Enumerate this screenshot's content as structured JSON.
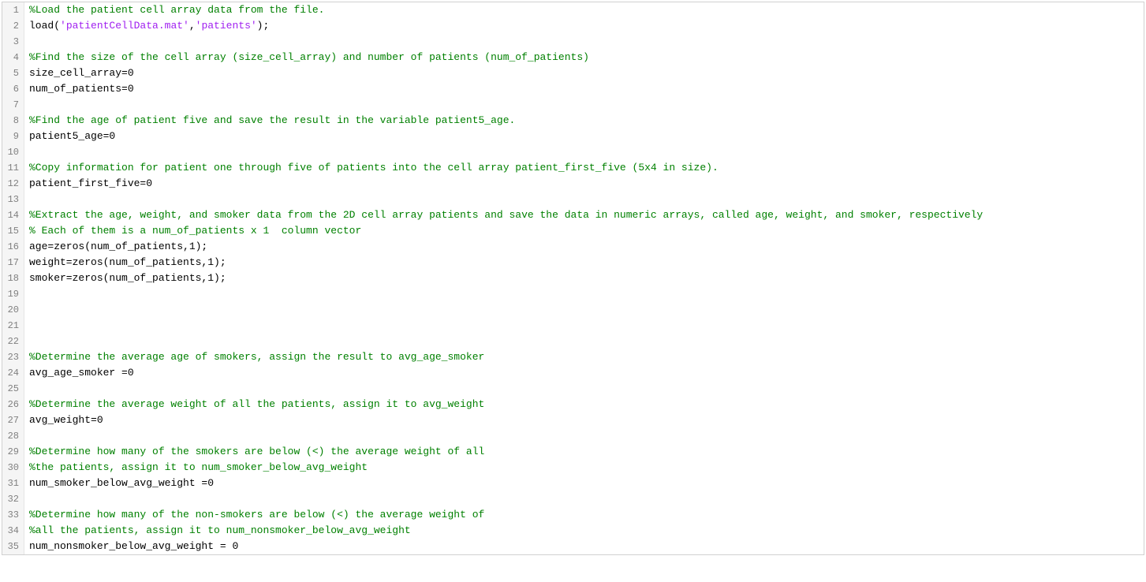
{
  "editor": {
    "lines": [
      {
        "num": 1,
        "tokens": [
          {
            "cls": "tok-comment",
            "text": "%Load the patient cell array data from the file."
          }
        ]
      },
      {
        "num": 2,
        "tokens": [
          {
            "cls": "tok-default",
            "text": "load("
          },
          {
            "cls": "tok-string",
            "text": "'patientCellData.mat'"
          },
          {
            "cls": "tok-default",
            "text": ","
          },
          {
            "cls": "tok-string",
            "text": "'patients'"
          },
          {
            "cls": "tok-default",
            "text": ");"
          }
        ]
      },
      {
        "num": 3,
        "tokens": []
      },
      {
        "num": 4,
        "tokens": [
          {
            "cls": "tok-comment",
            "text": "%Find the size of the cell array (size_cell_array) and number of patients (num_of_patients)"
          }
        ]
      },
      {
        "num": 5,
        "tokens": [
          {
            "cls": "tok-default",
            "text": "size_cell_array=0"
          }
        ]
      },
      {
        "num": 6,
        "tokens": [
          {
            "cls": "tok-default",
            "text": "num_of_patients=0"
          }
        ]
      },
      {
        "num": 7,
        "tokens": []
      },
      {
        "num": 8,
        "tokens": [
          {
            "cls": "tok-comment",
            "text": "%Find the age of patient five and save the result in the variable patient5_age."
          }
        ]
      },
      {
        "num": 9,
        "tokens": [
          {
            "cls": "tok-default",
            "text": "patient5_age=0"
          }
        ]
      },
      {
        "num": 10,
        "tokens": []
      },
      {
        "num": 11,
        "tokens": [
          {
            "cls": "tok-comment",
            "text": "%Copy information for patient one through five of patients into the cell array patient_first_five (5x4 in size)."
          }
        ]
      },
      {
        "num": 12,
        "tokens": [
          {
            "cls": "tok-default",
            "text": "patient_first_five=0"
          }
        ]
      },
      {
        "num": 13,
        "tokens": []
      },
      {
        "num": 14,
        "tokens": [
          {
            "cls": "tok-comment",
            "text": "%Extract the age, weight, and smoker data from the 2D cell array patients and save the data in numeric arrays, called age, weight, and smoker, respectively"
          }
        ]
      },
      {
        "num": 15,
        "tokens": [
          {
            "cls": "tok-comment",
            "text": "% Each of them is a num_of_patients x 1  column vector"
          }
        ]
      },
      {
        "num": 16,
        "tokens": [
          {
            "cls": "tok-default",
            "text": "age=zeros(num_of_patients,1);"
          }
        ]
      },
      {
        "num": 17,
        "tokens": [
          {
            "cls": "tok-default",
            "text": "weight=zeros(num_of_patients,1);"
          }
        ]
      },
      {
        "num": 18,
        "tokens": [
          {
            "cls": "tok-default",
            "text": "smoker=zeros(num_of_patients,1);"
          }
        ]
      },
      {
        "num": 19,
        "tokens": []
      },
      {
        "num": 20,
        "tokens": []
      },
      {
        "num": 21,
        "tokens": []
      },
      {
        "num": 22,
        "tokens": []
      },
      {
        "num": 23,
        "tokens": [
          {
            "cls": "tok-comment",
            "text": "%Determine the average age of smokers, assign the result to avg_age_smoker"
          }
        ]
      },
      {
        "num": 24,
        "tokens": [
          {
            "cls": "tok-default",
            "text": "avg_age_smoker =0"
          }
        ]
      },
      {
        "num": 25,
        "tokens": []
      },
      {
        "num": 26,
        "tokens": [
          {
            "cls": "tok-comment",
            "text": "%Determine the average weight of all the patients, assign it to avg_weight"
          }
        ]
      },
      {
        "num": 27,
        "tokens": [
          {
            "cls": "tok-default",
            "text": "avg_weight=0"
          }
        ]
      },
      {
        "num": 28,
        "tokens": []
      },
      {
        "num": 29,
        "tokens": [
          {
            "cls": "tok-comment",
            "text": "%Determine how many of the smokers are below (<) the average weight of all"
          }
        ]
      },
      {
        "num": 30,
        "tokens": [
          {
            "cls": "tok-comment",
            "text": "%the patients, assign it to num_smoker_below_avg_weight"
          }
        ]
      },
      {
        "num": 31,
        "tokens": [
          {
            "cls": "tok-default",
            "text": "num_smoker_below_avg_weight =0"
          }
        ]
      },
      {
        "num": 32,
        "tokens": []
      },
      {
        "num": 33,
        "tokens": [
          {
            "cls": "tok-comment",
            "text": "%Determine how many of the non-smokers are below (<) the average weight of"
          }
        ]
      },
      {
        "num": 34,
        "tokens": [
          {
            "cls": "tok-comment",
            "text": "%all the patients, assign it to num_nonsmoker_below_avg_weight"
          }
        ]
      },
      {
        "num": 35,
        "tokens": [
          {
            "cls": "tok-default",
            "text": "num_nonsmoker_below_avg_weight = 0"
          }
        ]
      }
    ]
  }
}
